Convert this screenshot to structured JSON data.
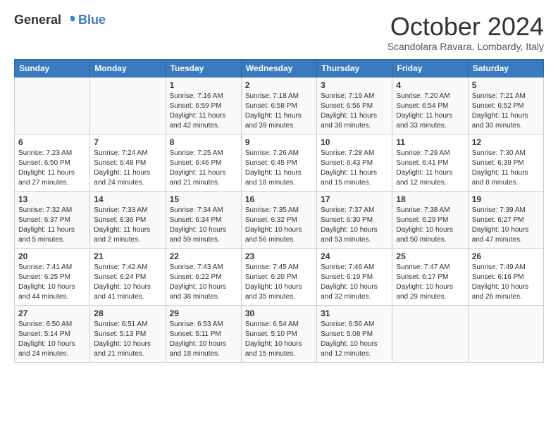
{
  "logo": {
    "general": "General",
    "blue": "Blue"
  },
  "title": "October 2024",
  "subtitle": "Scandolara Ravara, Lombardy, Italy",
  "days_of_week": [
    "Sunday",
    "Monday",
    "Tuesday",
    "Wednesday",
    "Thursday",
    "Friday",
    "Saturday"
  ],
  "weeks": [
    [
      {
        "day": "",
        "info": ""
      },
      {
        "day": "",
        "info": ""
      },
      {
        "day": "1",
        "info": "Sunrise: 7:16 AM\nSunset: 6:59 PM\nDaylight: 11 hours and 42 minutes."
      },
      {
        "day": "2",
        "info": "Sunrise: 7:18 AM\nSunset: 6:58 PM\nDaylight: 11 hours and 39 minutes."
      },
      {
        "day": "3",
        "info": "Sunrise: 7:19 AM\nSunset: 6:56 PM\nDaylight: 11 hours and 36 minutes."
      },
      {
        "day": "4",
        "info": "Sunrise: 7:20 AM\nSunset: 6:54 PM\nDaylight: 11 hours and 33 minutes."
      },
      {
        "day": "5",
        "info": "Sunrise: 7:21 AM\nSunset: 6:52 PM\nDaylight: 11 hours and 30 minutes."
      }
    ],
    [
      {
        "day": "6",
        "info": "Sunrise: 7:23 AM\nSunset: 6:50 PM\nDaylight: 11 hours and 27 minutes."
      },
      {
        "day": "7",
        "info": "Sunrise: 7:24 AM\nSunset: 6:48 PM\nDaylight: 11 hours and 24 minutes."
      },
      {
        "day": "8",
        "info": "Sunrise: 7:25 AM\nSunset: 6:46 PM\nDaylight: 11 hours and 21 minutes."
      },
      {
        "day": "9",
        "info": "Sunrise: 7:26 AM\nSunset: 6:45 PM\nDaylight: 11 hours and 18 minutes."
      },
      {
        "day": "10",
        "info": "Sunrise: 7:28 AM\nSunset: 6:43 PM\nDaylight: 11 hours and 15 minutes."
      },
      {
        "day": "11",
        "info": "Sunrise: 7:29 AM\nSunset: 6:41 PM\nDaylight: 11 hours and 12 minutes."
      },
      {
        "day": "12",
        "info": "Sunrise: 7:30 AM\nSunset: 6:39 PM\nDaylight: 11 hours and 8 minutes."
      }
    ],
    [
      {
        "day": "13",
        "info": "Sunrise: 7:32 AM\nSunset: 6:37 PM\nDaylight: 11 hours and 5 minutes."
      },
      {
        "day": "14",
        "info": "Sunrise: 7:33 AM\nSunset: 6:36 PM\nDaylight: 11 hours and 2 minutes."
      },
      {
        "day": "15",
        "info": "Sunrise: 7:34 AM\nSunset: 6:34 PM\nDaylight: 10 hours and 59 minutes."
      },
      {
        "day": "16",
        "info": "Sunrise: 7:35 AM\nSunset: 6:32 PM\nDaylight: 10 hours and 56 minutes."
      },
      {
        "day": "17",
        "info": "Sunrise: 7:37 AM\nSunset: 6:30 PM\nDaylight: 10 hours and 53 minutes."
      },
      {
        "day": "18",
        "info": "Sunrise: 7:38 AM\nSunset: 6:29 PM\nDaylight: 10 hours and 50 minutes."
      },
      {
        "day": "19",
        "info": "Sunrise: 7:39 AM\nSunset: 6:27 PM\nDaylight: 10 hours and 47 minutes."
      }
    ],
    [
      {
        "day": "20",
        "info": "Sunrise: 7:41 AM\nSunset: 6:25 PM\nDaylight: 10 hours and 44 minutes."
      },
      {
        "day": "21",
        "info": "Sunrise: 7:42 AM\nSunset: 6:24 PM\nDaylight: 10 hours and 41 minutes."
      },
      {
        "day": "22",
        "info": "Sunrise: 7:43 AM\nSunset: 6:22 PM\nDaylight: 10 hours and 38 minutes."
      },
      {
        "day": "23",
        "info": "Sunrise: 7:45 AM\nSunset: 6:20 PM\nDaylight: 10 hours and 35 minutes."
      },
      {
        "day": "24",
        "info": "Sunrise: 7:46 AM\nSunset: 6:19 PM\nDaylight: 10 hours and 32 minutes."
      },
      {
        "day": "25",
        "info": "Sunrise: 7:47 AM\nSunset: 6:17 PM\nDaylight: 10 hours and 29 minutes."
      },
      {
        "day": "26",
        "info": "Sunrise: 7:49 AM\nSunset: 6:16 PM\nDaylight: 10 hours and 26 minutes."
      }
    ],
    [
      {
        "day": "27",
        "info": "Sunrise: 6:50 AM\nSunset: 5:14 PM\nDaylight: 10 hours and 24 minutes."
      },
      {
        "day": "28",
        "info": "Sunrise: 6:51 AM\nSunset: 5:13 PM\nDaylight: 10 hours and 21 minutes."
      },
      {
        "day": "29",
        "info": "Sunrise: 6:53 AM\nSunset: 5:11 PM\nDaylight: 10 hours and 18 minutes."
      },
      {
        "day": "30",
        "info": "Sunrise: 6:54 AM\nSunset: 5:10 PM\nDaylight: 10 hours and 15 minutes."
      },
      {
        "day": "31",
        "info": "Sunrise: 6:56 AM\nSunset: 5:08 PM\nDaylight: 10 hours and 12 minutes."
      },
      {
        "day": "",
        "info": ""
      },
      {
        "day": "",
        "info": ""
      }
    ]
  ]
}
